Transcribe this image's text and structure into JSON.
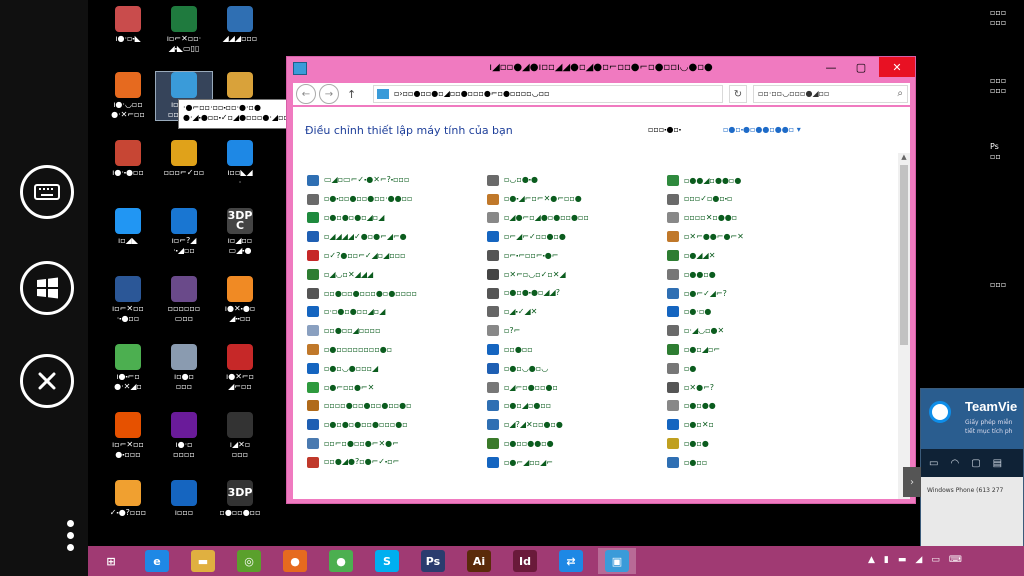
{
  "sidebar": {
    "buttons": [
      {
        "name": "keyboard-button",
        "icon": "keyboard-icon"
      },
      {
        "name": "windows-start-button",
        "icon": "windows-icon"
      },
      {
        "name": "close-session-button",
        "icon": "close-icon"
      }
    ],
    "more_icon": "more-vertical-icon"
  },
  "desktop_icons": [
    {
      "label": "ı●·▫⬝◣",
      "icon": "app-icon",
      "color": "#c94c4c"
    },
    {
      "label": "ı▫⌐✕▫▫·\n◢⬝◣▭▯▯",
      "icon": "excel-icon",
      "color": "#1f7a3e"
    },
    {
      "label": "◢◢◢▫▫▫",
      "icon": "computer-icon",
      "color": "#2f6fb3"
    },
    {
      "label": "ı●·◡▫▫\n●·✕⌐▫▫",
      "icon": "firefox-icon",
      "color": "#e66a1f"
    },
    {
      "label": "ı▫⌐⬝●·\n▫▫◢▭▭",
      "icon": "control-panel-icon",
      "color": "#3a9bd9",
      "selected": true
    },
    {
      "label": "",
      "icon": "folder-icon",
      "color": "#d9a23a"
    },
    {
      "label": "ı●·⬝●▫▫",
      "icon": "powerpoint-icon",
      "color": "#c74634"
    },
    {
      "label": "▫▫▫⌐✓▫▫",
      "icon": "media-player-icon",
      "color": "#e0a21a"
    },
    {
      "label": "ı▫▫◣◢\n·",
      "icon": "teamviewer-icon",
      "color": "#1e88e5"
    },
    {
      "label": "ı▫◢◣",
      "icon": "skype-icon",
      "color": "#2196f3"
    },
    {
      "label": "ı▫⌐?◢\n·⬝◢▫▫",
      "icon": "ie-icon",
      "color": "#1976d2"
    },
    {
      "label": "ı▫◢▫▫\n▭◢⬝●",
      "icon": "3dp-chip-icon",
      "color": "#444444",
      "text": "3DP C"
    },
    {
      "label": "ı▫⌐✕▫▫\n·⬝●▫▫",
      "icon": "word-icon",
      "color": "#2b5797"
    },
    {
      "label": "▫▫▫▫▫▫\n▭▫▫",
      "icon": "winrar-icon",
      "color": "#6a4a8a"
    },
    {
      "label": "ı●✕⬝●▫\n◢⬝⬝▫▫",
      "icon": "avast-icon",
      "color": "#f08a24"
    },
    {
      "label": "ı●⬝⌐▫\n●·✕◢▫",
      "icon": "chrome-icon",
      "color": "#4caf50"
    },
    {
      "label": "ı▫●▫\n▫▫▫",
      "icon": "recycle-bin-icon",
      "color": "#8a9bb0"
    },
    {
      "label": "ı●✕⌐▫\n◢⌐▫▫",
      "icon": "pdf-icon",
      "color": "#c62828"
    },
    {
      "label": "ı▫⌐✕▫▫\n●⬝▫▫▫",
      "icon": "office-icon",
      "color": "#e65100"
    },
    {
      "label": "ı●·▫\n▫▫▫▫",
      "icon": "yahoo-icon",
      "color": "#6a1b9a"
    },
    {
      "label": "ı◢✕▫\n▫▫▫",
      "icon": "shield-icon",
      "color": "#333333"
    },
    {
      "label": "✓⬝●?▫▫▫",
      "icon": "app-icon",
      "color": "#f0a030"
    },
    {
      "label": "ı▫▫▫",
      "icon": "network-icon",
      "color": "#1565c0"
    },
    {
      "label": "▫●▫▫●▫▫",
      "icon": "3dp-net-icon",
      "color": "#333333",
      "text": "3DP"
    }
  ],
  "tooltip": {
    "line1": "·●⌐▫▫·▫▫⬝▫▫·●·▫●",
    "line2": "●·◢⬝●▫▫⬝✓▫◢●▫▫▫●·◢▫▫⌐◢▫●⬝▫▫"
  },
  "window": {
    "title": "ı◢▫▫●◢●ı▫▫◢◢●▫◢●▫⌐▫▫●⌐▫●▫▫ı◡●▫●",
    "minimize": "—",
    "maximize": "▢",
    "close": "✕",
    "address": "▫›▫▫●▫▫●▫◢▫▫●▫▫▫●⌐▫●▫▫▫▫◡▫▫",
    "address_chevron": "›",
    "search_placeholder": "▫▫·▫▫◡▫▫▫●◢▫▫",
    "heading": "Điều chỉnh thiết lập máy tính của bạn",
    "view_by_label": "▫▫▫⬝●▫⬝",
    "view_by_value": "▫●▫⬝●▫●●▫●●▫",
    "columns": [
      [
        {
          "label": "▭◢▫▭⌐✓⬝●✕⌐?⬝▫▫▫",
          "color": "#2f6fb3"
        },
        {
          "label": "▫●⬝▫▫●▫▫●▫▫·●●▫▫",
          "color": "#6a6a6a"
        },
        {
          "label": "▫●▫●▫●▫◢▫◢",
          "color": "#1f8a3e"
        },
        {
          "label": "▫◢◢◢◢✓●▫●⌐◢⌐●",
          "color": "#1f5fb3"
        },
        {
          "label": "▫✓?●▫▫⌐✓◢▫◢▫▫▫",
          "color": "#c62828"
        },
        {
          "label": "▫◢◡▫✕◢◢◢",
          "color": "#2e7d32"
        },
        {
          "label": "▫▫●▫▫●▫▫▫●▫●▫▫▫▫",
          "color": "#555555"
        },
        {
          "label": "▫·▫●▫●▫▫◢▫◢",
          "color": "#1565c0"
        },
        {
          "label": "▫▫●▫▫◢▫▫▫▫",
          "color": "#8aa0c0"
        },
        {
          "label": "▫●▫▫▫▫▫▫▫▫●▫",
          "color": "#c0782a"
        },
        {
          "label": "▫●▫◡●▫▫▫◢",
          "color": "#1565c0"
        },
        {
          "label": "▫●⌐▫▫●⌐✕",
          "color": "#2e9a3e"
        },
        {
          "label": "▫▫▫▫●▫▫●▫▫●▫▫●▫",
          "color": "#b06a1a"
        },
        {
          "label": "▫●▫●▫●▫▫●▫▫▫●▫",
          "color": "#1f5fb3"
        },
        {
          "label": "▫▫⌐▫●▫▫●⌐✕●⌐",
          "color": "#4a7ab0"
        },
        {
          "label": "▫▫●◢●?▫●⌐✓⬝▫⌐",
          "color": "#c0392b"
        }
      ],
      [
        {
          "label": "▫◡▫●⬝●",
          "color": "#6a6a6a"
        },
        {
          "label": "▫●⬝◢⌐▫⌐✕●⌐▫▫●",
          "color": "#c0782a"
        },
        {
          "label": "▫◢●⌐▫◢●▫●▫▫●▫▫",
          "color": "#888888"
        },
        {
          "label": "▫⌐◢⌐✓▫▫●▫●",
          "color": "#1565c0"
        },
        {
          "label": "▫⌐⬝⌐▫▫⌐⬝●⌐",
          "color": "#555555"
        },
        {
          "label": "▫✕⌐▫◡▫✓▫✕◢",
          "color": "#444444"
        },
        {
          "label": "▫●▫●⬝●▫◢◢?",
          "color": "#555555"
        },
        {
          "label": "▫◢⬝✓◢✕",
          "color": "#666666"
        },
        {
          "label": "▫?⌐",
          "color": "#888888"
        },
        {
          "label": "▫▫●▫▫",
          "color": "#1565c0"
        },
        {
          "label": "▫●▫◡●▫◡",
          "color": "#1e5fb3"
        },
        {
          "label": "▫◢⌐▫●▫▫●▫",
          "color": "#777777"
        },
        {
          "label": "▫●▫◢▫●▫▫",
          "color": "#2f6fb3"
        },
        {
          "label": "▫◢?◢✕▫▫●▫●",
          "color": "#2f6fb3"
        },
        {
          "label": "▫●▫▫●●▫●",
          "color": "#3a7a2a"
        },
        {
          "label": "▫●⌐◢▫▫◢⌐",
          "color": "#1565c0"
        }
      ],
      [
        {
          "label": "▫●●◢▫●●▫●",
          "color": "#2f8a3e"
        },
        {
          "label": "▫▫▫✓▫●▫⬝▫",
          "color": "#6a6a6a"
        },
        {
          "label": "▫▫▫▫✕▫●●▫",
          "color": "#888888"
        },
        {
          "label": "▫✕⌐●●⌐●⌐✕",
          "color": "#c0782a"
        },
        {
          "label": "▫●◢◢✕",
          "color": "#2e7d32"
        },
        {
          "label": "▫●●▫●",
          "color": "#777777"
        },
        {
          "label": "▫●⌐✓◢⌐?",
          "color": "#2f6fb3"
        },
        {
          "label": "▫●·▫●",
          "color": "#1565c0"
        },
        {
          "label": "▫·◢◡▫●✕",
          "color": "#6a6a6a"
        },
        {
          "label": "▫●▫◢▫⌐",
          "color": "#2e7d32"
        },
        {
          "label": "▫●",
          "color": "#777777"
        },
        {
          "label": "▫✕●⌐?",
          "color": "#555555"
        },
        {
          "label": "▫●▫●●",
          "color": "#888888"
        },
        {
          "label": "▫●▫✕▫",
          "color": "#1565c0"
        },
        {
          "label": "▫●▫●",
          "color": "#c0a020"
        },
        {
          "label": "▫●▫▫",
          "color": "#2f6fb3"
        }
      ]
    ]
  },
  "teamviewer": {
    "name": "TeamVie",
    "sub1": "Giấy phép miễn",
    "sub2": "tiết mục tích ph",
    "footer": "Windows Phone (613 277",
    "handle": "›"
  },
  "right_edge": [
    {
      "label": "▫▫▫\n▫▫▫",
      "icon": "doc-icon"
    },
    {
      "label": "▫▫▫\n▫▫▫",
      "icon": "doc-icon"
    },
    {
      "label": "Ps\n▫▫",
      "icon": "photoshop-icon"
    },
    {
      "label": "▫▫▫",
      "icon": "folder-icon"
    }
  ],
  "taskbar": {
    "items": [
      {
        "name": "start",
        "icon": "windows-icon",
        "glyph": "⊞",
        "color": "#ffffff"
      },
      {
        "name": "ie",
        "icon": "ie-icon",
        "glyph": "e",
        "color": "#1e88e5"
      },
      {
        "name": "explorer",
        "icon": "folder-icon",
        "glyph": "▬",
        "color": "#e0b040"
      },
      {
        "name": "browser",
        "icon": "app-icon",
        "glyph": "◎",
        "color": "#5aa02c"
      },
      {
        "name": "firefox",
        "icon": "firefox-icon",
        "glyph": "●",
        "color": "#e66a1f"
      },
      {
        "name": "chrome",
        "icon": "chrome-icon",
        "glyph": "●",
        "color": "#4caf50"
      },
      {
        "name": "skype",
        "icon": "skype-icon",
        "glyph": "S",
        "color": "#00aff0"
      },
      {
        "name": "photoshop",
        "icon": "photoshop-icon",
        "glyph": "Ps",
        "color": "#2b3c6e"
      },
      {
        "name": "illustrator",
        "icon": "illustrator-icon",
        "glyph": "Ai",
        "color": "#5a2a0a"
      },
      {
        "name": "indesign",
        "icon": "indesign-icon",
        "glyph": "Id",
        "color": "#6a1a3a"
      },
      {
        "name": "teamviewer",
        "icon": "teamviewer-icon",
        "glyph": "⇄",
        "color": "#1e88e5"
      },
      {
        "name": "control-panel",
        "icon": "control-panel-icon",
        "glyph": "▣",
        "color": "#3a9bd9",
        "active": true
      }
    ],
    "tray": [
      "▲",
      "▮",
      "▬",
      "◢",
      "▭",
      "⌨"
    ]
  }
}
